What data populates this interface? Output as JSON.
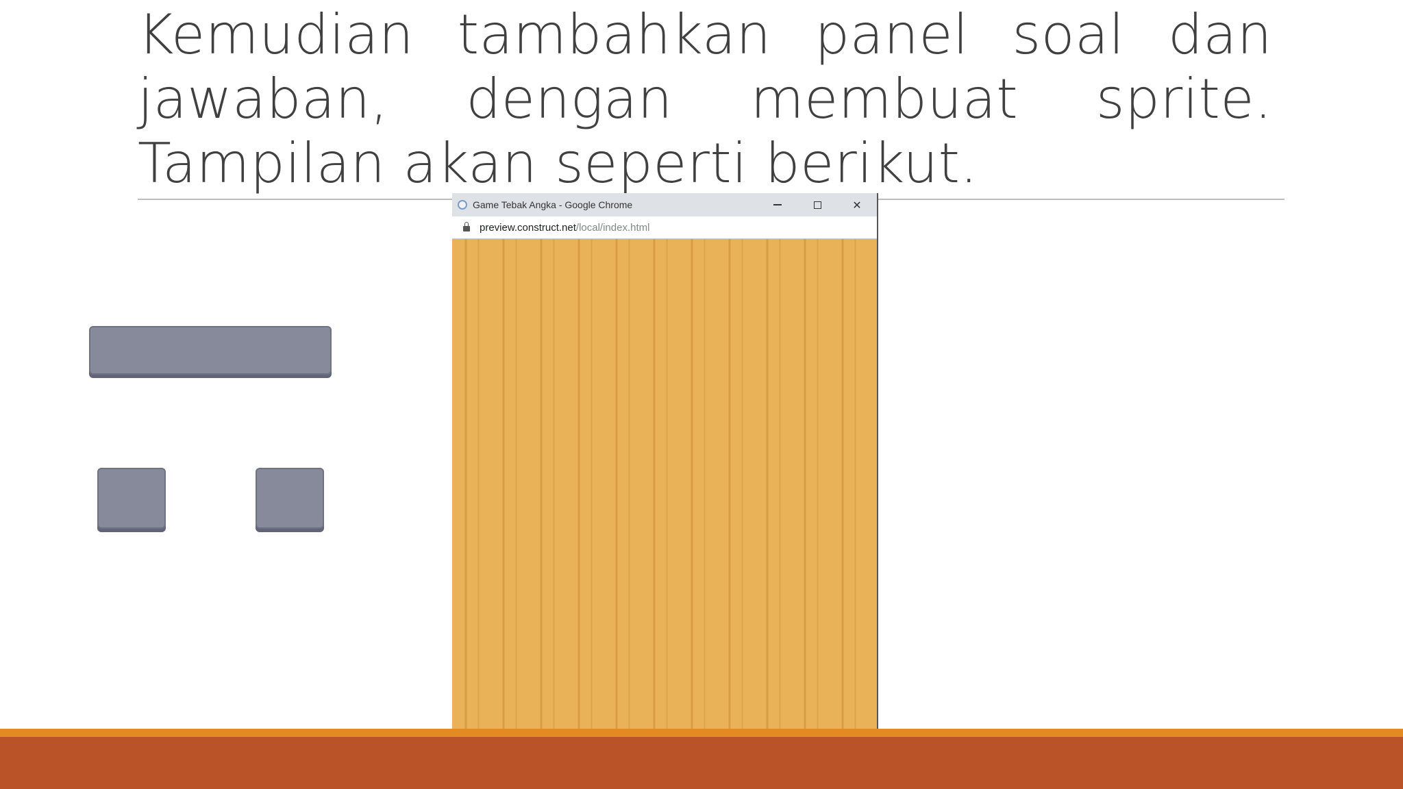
{
  "slide": {
    "text": "Kemudian tambahkan panel soal dan jawaban, dengan membuat sprite. Tampilan akan seperti berikut."
  },
  "browser": {
    "window_title": "Game Tebak Angka - Google Chrome",
    "url_host": "preview.construct.net",
    "url_path": "/local/index.html",
    "minimize_icon": "minimize-icon",
    "maximize_icon": "maximize-icon",
    "close_label": "✕"
  },
  "colors": {
    "wood": "#e9b158",
    "panel": "#878a9b",
    "footer_stripe": "#e38b22",
    "footer_bar": "#bb5329"
  }
}
